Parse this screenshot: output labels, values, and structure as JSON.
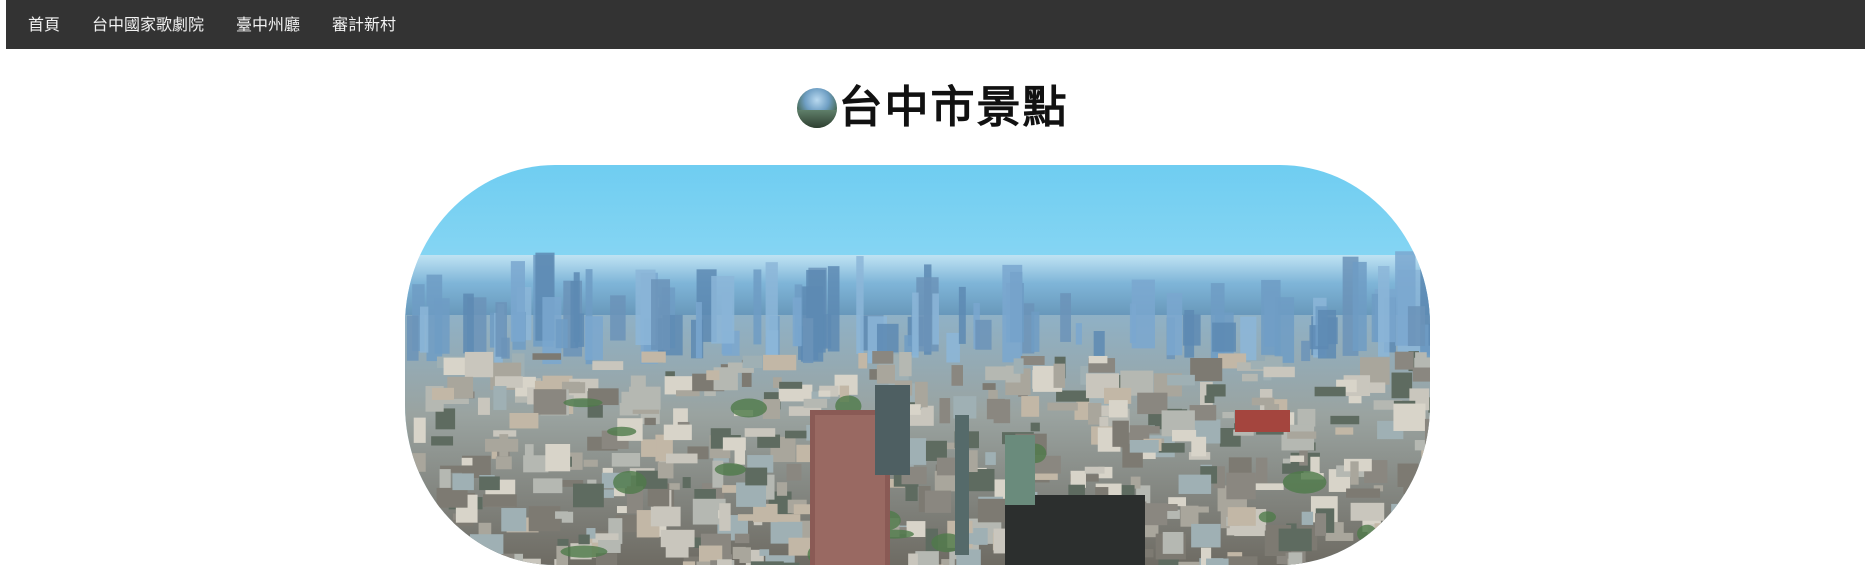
{
  "navbar": {
    "items": [
      {
        "label": "首頁"
      },
      {
        "label": "台中國家歌劇院"
      },
      {
        "label": "臺中州廳"
      },
      {
        "label": "審計新村"
      }
    ],
    "background": "#333333",
    "text_color": "#f2f2f2"
  },
  "header": {
    "title": "台中市景點",
    "icon": "city-globe-icon"
  },
  "hero": {
    "image": "taichung-city-skyline-panorama"
  }
}
